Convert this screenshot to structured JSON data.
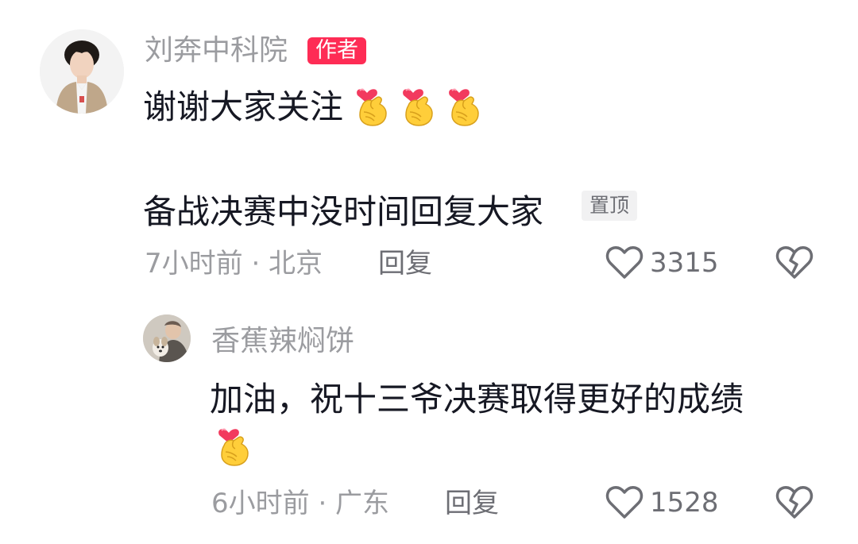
{
  "comments": [
    {
      "username": "刘奔中科院",
      "author_badge": "作者",
      "lines": [
        "谢谢大家关注",
        "备战决赛中没时间回复大家"
      ],
      "pin_badge": "置顶",
      "meta": "7小时前 · 北京",
      "reply_label": "回复",
      "likes": "3315",
      "avatar_icon": "person-avatar",
      "emoji_icon": "finger-heart-emoji"
    },
    {
      "username": "香蕉辣焖饼",
      "lines": [
        "加油，祝十三爷决赛取得更好的成绩"
      ],
      "meta": "6小时前 · 广东",
      "reply_label": "回复",
      "likes": "1528",
      "avatar_icon": "person-with-dog-avatar",
      "emoji_icon": "finger-heart-emoji"
    }
  ],
  "colors": {
    "author_badge_bg": "#fe2c55",
    "username_text": "#9b9ca0",
    "content_text": "#161823",
    "secondary_text": "#6d6e74",
    "pin_badge_bg": "#f1f1f2"
  }
}
